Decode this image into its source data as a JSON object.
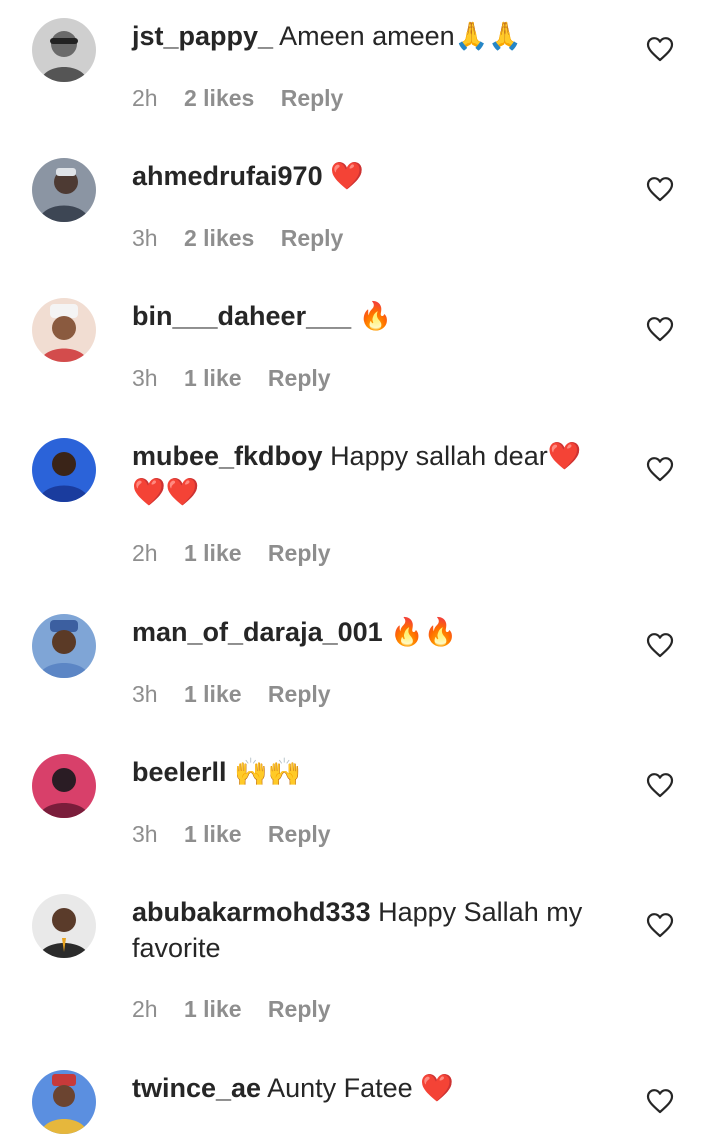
{
  "comments": [
    {
      "username": "jst_pappy_",
      "text": "Ameen ameen🙏🙏",
      "time": "2h",
      "likes": "2 likes",
      "reply": "Reply",
      "avatar_color": "#9e9e9e",
      "like_icon": "heart-outline-icon"
    },
    {
      "username": "ahmedrufai970",
      "text": "❤️",
      "time": "3h",
      "likes": "2 likes",
      "reply": "Reply",
      "avatar_color": "#6f7d8c",
      "like_icon": "heart-outline-icon"
    },
    {
      "username": "bin___daheer___",
      "text": "🔥",
      "time": "3h",
      "likes": "1 like",
      "reply": "Reply",
      "avatar_color": "#e3b9a6",
      "like_icon": "heart-outline-icon"
    },
    {
      "username": "mubee_fkdboy",
      "text": "Happy sallah dear❤️❤️❤️",
      "time": "2h",
      "likes": "1 like",
      "reply": "Reply",
      "avatar_color": "#1f4fb5",
      "like_icon": "heart-outline-icon"
    },
    {
      "username": "man_of_daraja_001",
      "text": "🔥🔥",
      "time": "3h",
      "likes": "1 like",
      "reply": "Reply",
      "avatar_color": "#4a6ea8",
      "like_icon": "heart-outline-icon"
    },
    {
      "username": "beelerll",
      "text": "🙌🙌",
      "time": "3h",
      "likes": "1 like",
      "reply": "Reply",
      "avatar_color": "#c0395b",
      "like_icon": "heart-outline-icon"
    },
    {
      "username": "abubakarmohd333",
      "text": "Happy Sallah my favorite",
      "time": "2h",
      "likes": "1 like",
      "reply": "Reply",
      "avatar_color": "#d8d8d8",
      "like_icon": "heart-outline-icon"
    },
    {
      "username": "twince_ae",
      "text": "Aunty Fatee ❤️",
      "avatar_color": "#3b73c9",
      "like_icon": "heart-outline-icon"
    }
  ]
}
